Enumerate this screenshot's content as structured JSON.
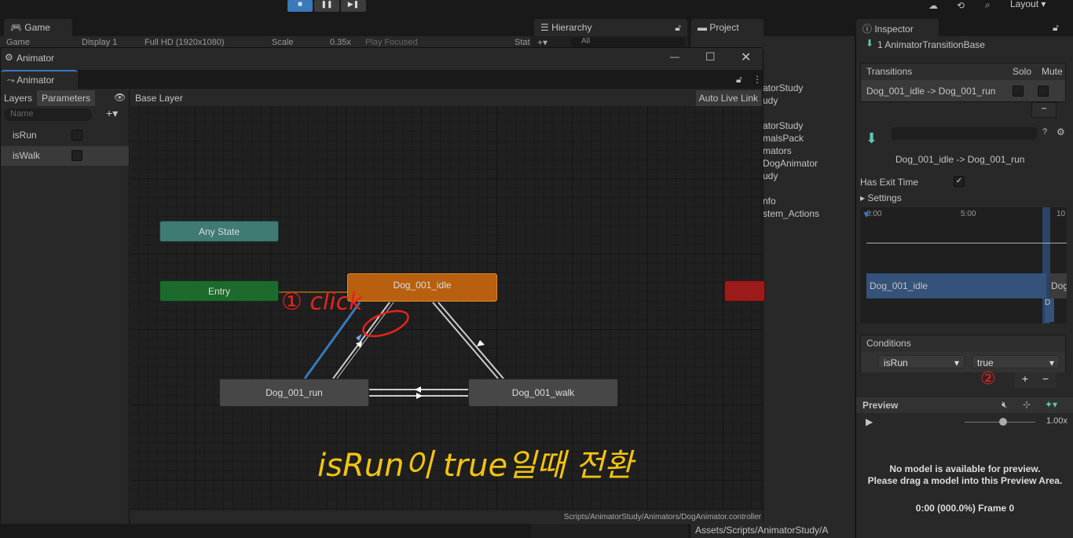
{
  "toolbar": {
    "play": "■",
    "pause": "❚❚",
    "step": "▶❚",
    "layout": "Layout"
  },
  "game": {
    "tab": "Game",
    "display_label": "Game",
    "display": "Display 1",
    "resolution": "Full HD (1920x1080)",
    "scale_label": "Scale",
    "scale": "0.35x",
    "play_mode": "Play Focused",
    "stats": "Stat"
  },
  "hierarchy": {
    "tab": "Hierarchy",
    "search_placeholder": "All"
  },
  "project": {
    "tab": "Project",
    "items": [
      "atorStudy",
      "udy",
      "atorStudy",
      "malsPack",
      "mators",
      "DogAnimator",
      "udy",
      "nfo",
      "stem_Actions"
    ],
    "path": "Assets/Scripts/AnimatorStudy/A"
  },
  "animator_window": {
    "title": "Animator",
    "tab": "Animator",
    "left_tabs": [
      "Layers",
      "Parameters"
    ],
    "search_placeholder": "Name",
    "parameters": [
      {
        "name": "isRun",
        "value": false
      },
      {
        "name": "isWalk",
        "value": false
      }
    ],
    "breadcrumb": "Base Layer",
    "auto_live_link": "Auto Live Link",
    "status_path": "Scripts/AnimatorStudy/Animators/DogAnimator.controller",
    "states": {
      "any": "Any State",
      "entry": "Entry",
      "idle": "Dog_001_idle",
      "run": "Dog_001_run",
      "walk": "Dog_001_walk"
    }
  },
  "annotations": {
    "click": "① click",
    "step2": "②",
    "caption": "isRun이 true일때 전환"
  },
  "inspector": {
    "tab": "Inspector",
    "header": "1 AnimatorTransitionBase",
    "transitions_label": "Transitions",
    "solo": "Solo",
    "mute": "Mute",
    "transition": "Dog_001_idle -> Dog_001_run",
    "transition_title": "Dog_001_idle -> Dog_001_run",
    "has_exit_time_label": "Has Exit Time",
    "has_exit_time": true,
    "settings": "Settings",
    "timeline_ticks": [
      "0:00",
      "5:00",
      "10"
    ],
    "clip_from": "Dog_001_idle",
    "clip_to": "Dog",
    "clip_to_short": "D",
    "conditions_label": "Conditions",
    "condition": {
      "param": "isRun",
      "value": "true"
    },
    "plus": "+",
    "minus": "−",
    "preview": {
      "label": "Preview",
      "speed": "1.00x",
      "message1": "No model is available for preview.",
      "message2": "Please drag a model into this Preview Area.",
      "frame": "0:00 (000.0%) Frame 0"
    }
  },
  "colors": {
    "accent": "#3a79bb",
    "any_state": "#3f7a73",
    "entry": "#1c6b2c",
    "default_state": "#b8600f",
    "exit": "#9b1b1b",
    "annotation_red": "#e8221c",
    "annotation_yellow": "#f2c40e"
  }
}
